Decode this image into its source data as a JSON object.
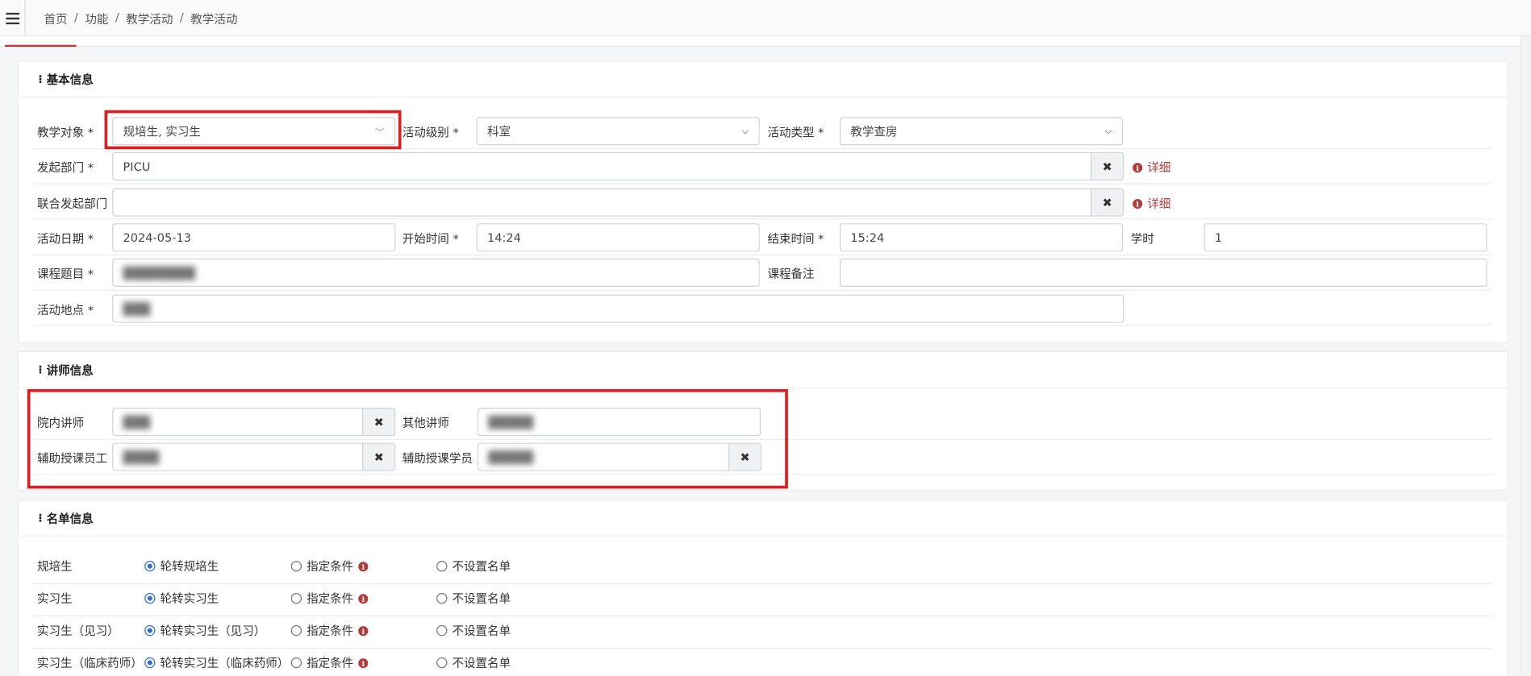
{
  "breadcrumb": [
    "首页",
    "功能",
    "教学活动",
    "教学活动"
  ],
  "colors": {
    "accent": "#c8343a",
    "highlight_box": "#e21b1b",
    "radio": "#2d6fd6",
    "detail_link": "#b73a3a"
  },
  "basic": {
    "title": "基本信息",
    "teach_target_label": "教学对象 *",
    "teach_target_value": "规培生, 实习生",
    "level_label": "活动级别 *",
    "level_value": "科室",
    "type_label": "活动类型 *",
    "type_value": "教学查房",
    "dept_label": "发起部门 *",
    "dept_value": "PICU",
    "joint_dept_label": "联合发起部门",
    "joint_dept_value": "",
    "detail_label": "详细",
    "date_label": "活动日期 *",
    "date_value": "2024-05-13",
    "start_label": "开始时间 *",
    "start_value": "14:24",
    "end_label": "结束时间 *",
    "end_value": "15:24",
    "hours_label": "学时",
    "hours_value": "1",
    "course_label": "课程题目 *",
    "course_value": "████████",
    "course_note_label": "课程备注",
    "course_note_value": "",
    "place_label": "活动地点 *",
    "place_value": "███"
  },
  "lecturer": {
    "title": "讲师信息",
    "inner_label": "院内讲师",
    "inner_value": "███",
    "other_label": "其他讲师",
    "other_value": "█████",
    "assist_staff_label": "辅助授课员工",
    "assist_staff_value": "████",
    "assist_student_label": "辅助授课学员",
    "assist_student_value": "█████"
  },
  "roster": {
    "title": "名单信息",
    "cond_label": "指定条件",
    "none_label": "不设置名单",
    "rows": [
      {
        "label": "规培生",
        "rotate": "轮转规培生"
      },
      {
        "label": "实习生",
        "rotate": "轮转实习生"
      },
      {
        "label": "实习生（见习）",
        "rotate": "轮转实习生（见习）"
      },
      {
        "label": "实习生（临床药师）",
        "rotate": "轮转实习生（临床药师）"
      }
    ]
  }
}
